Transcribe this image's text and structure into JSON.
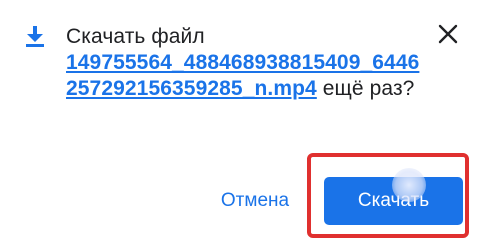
{
  "dialog": {
    "title": "Скачать файл",
    "file_name": "149755564_488468938815409_6446257292156359285_n.mp4",
    "question_suffix": " ещё раз?",
    "cancel_label": "Отмена",
    "download_label": "Скачать"
  },
  "icons": {
    "download": "download-arrow-icon",
    "close": "close-icon"
  },
  "colors": {
    "accent": "#1a73e8",
    "text": "#202124",
    "highlight": "#e0302f"
  }
}
